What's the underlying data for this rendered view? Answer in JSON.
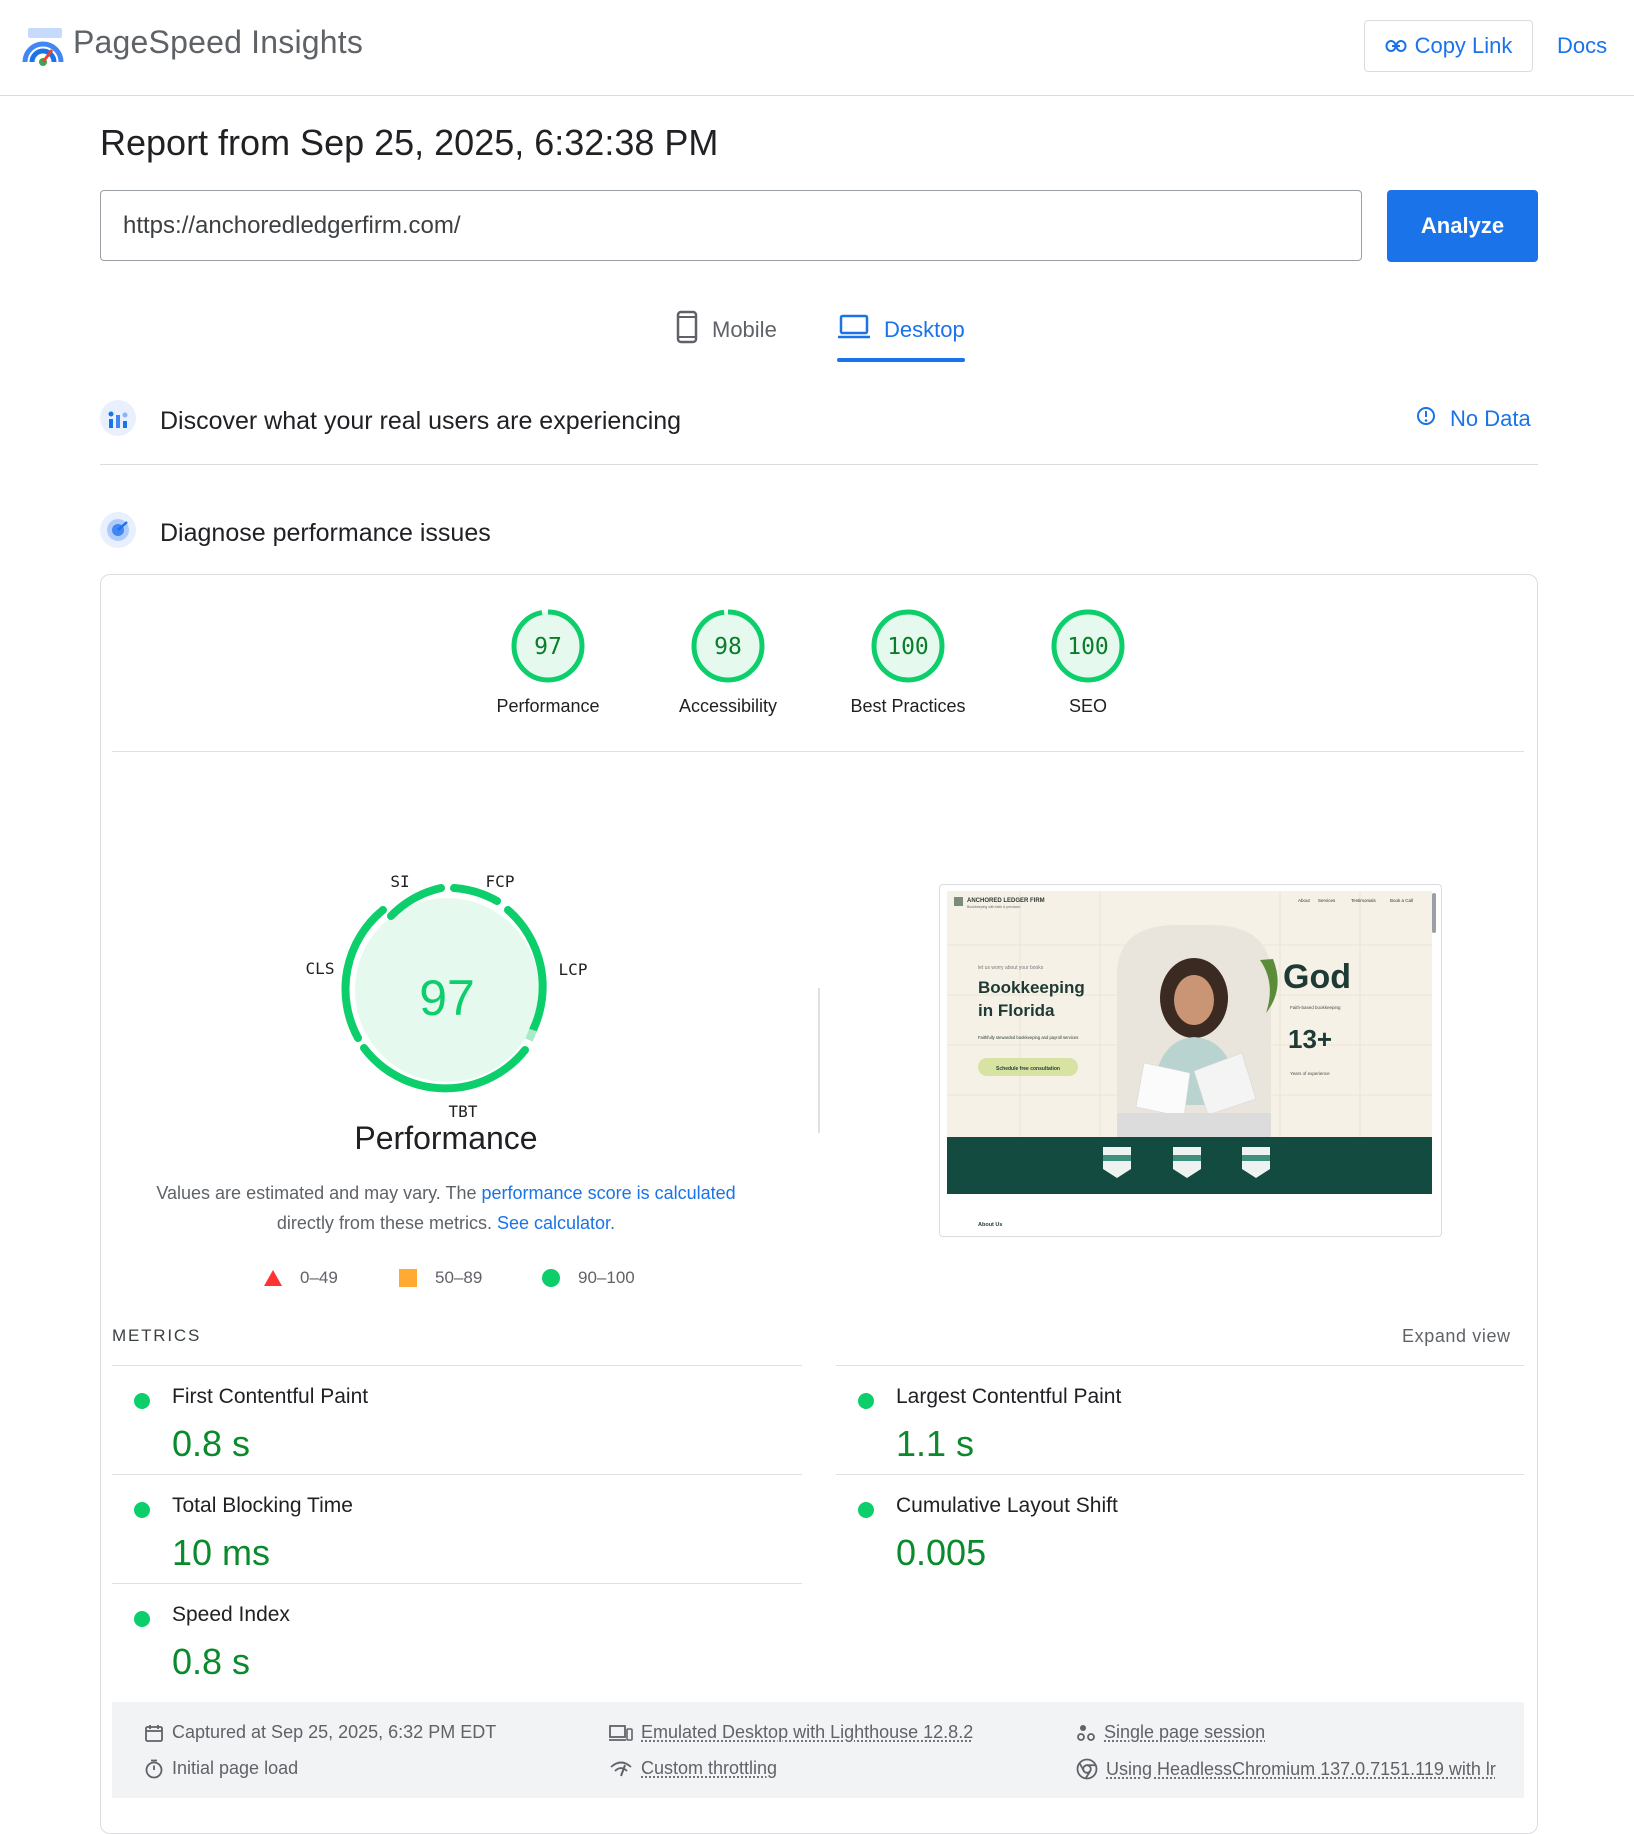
{
  "header": {
    "brand": "PageSpeed Insights",
    "copy_link_label": "Copy Link",
    "docs_label": "Docs"
  },
  "report": {
    "title": "Report from Sep 25, 2025, 6:32:38 PM",
    "url": "https://anchoredledgerfirm.com/",
    "analyze_label": "Analyze"
  },
  "tabs": [
    {
      "label": "Mobile",
      "selected": false
    },
    {
      "label": "Desktop",
      "selected": true
    }
  ],
  "field_data": {
    "heading": "Discover what your real users are experiencing",
    "status": "No Data"
  },
  "diagnose": {
    "heading": "Diagnose performance issues"
  },
  "categories": [
    {
      "label": "Performance",
      "score": "97",
      "value": 97
    },
    {
      "label": "Accessibility",
      "score": "98",
      "value": 98
    },
    {
      "label": "Best Practices",
      "score": "100",
      "value": 100
    },
    {
      "label": "SEO",
      "score": "100",
      "value": 100
    }
  ],
  "performance_gauge": {
    "score": "97",
    "label": "Performance",
    "segments": [
      "SI",
      "FCP",
      "LCP",
      "TBT",
      "CLS"
    ]
  },
  "description": {
    "part1": "Values are estimated and may vary. The ",
    "link1": "performance score is calculated",
    "part2": " directly from these metrics. ",
    "link2": "See calculator."
  },
  "legend": [
    {
      "range": "0–49",
      "shape": "triangle",
      "color": "#ff3333"
    },
    {
      "range": "50–89",
      "shape": "square",
      "color": "#ffaa33"
    },
    {
      "range": "90–100",
      "shape": "circle",
      "color": "#0cce6b"
    }
  ],
  "screenshot": {
    "brand": "ANCHORED LEDGER FIRM",
    "tagline": "Bookkeeping with faith & precision",
    "nav": [
      "About",
      "Services",
      "Testimonials",
      "Book a Call"
    ],
    "eyebrow": "let us worry about your books",
    "headline_line1": "Bookkeeping",
    "headline_line2": "in Florida",
    "sub": "Faithfully stewarded bookkeeping and payroll services",
    "cta": "Schedule free consultation",
    "big_word": "God",
    "big_word_sub": "Faith-based bookkeeping",
    "stat": "13+",
    "stat_sub": "Years of experience",
    "footer_link": "About Us"
  },
  "metrics": {
    "title": "METRICS",
    "expand_label": "Expand view",
    "items": [
      {
        "name": "First Contentful Paint",
        "value": "0.8 s"
      },
      {
        "name": "Largest Contentful Paint",
        "value": "1.1 s"
      },
      {
        "name": "Total Blocking Time",
        "value": "10 ms"
      },
      {
        "name": "Cumulative Layout Shift",
        "value": "0.005"
      },
      {
        "name": "Speed Index",
        "value": "0.8 s"
      }
    ]
  },
  "footer": {
    "captured": "Captured at Sep 25, 2025, 6:32 PM EDT",
    "initial_load": "Initial page load",
    "emulated": "Emulated Desktop with Lighthouse 12.8.2",
    "throttling": "Custom throttling",
    "session": "Single page session",
    "browser": "Using HeadlessChromium 137.0.7151.119 with lr"
  },
  "colors": {
    "accent": "#1a73e8",
    "pass": "#0cce6b",
    "pass_text": "#0a8a2c",
    "pass_bg": "#e6f9ee"
  }
}
